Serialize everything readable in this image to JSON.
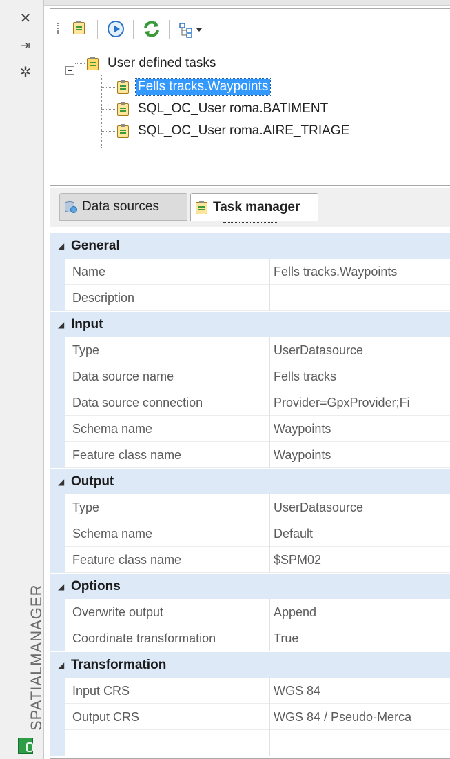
{
  "palette": {
    "title": "SPATIALMANAGER",
    "buttons": [
      {
        "icon": "close-icon",
        "glyph": "✕"
      },
      {
        "icon": "auto-hide-icon",
        "glyph": "⇥"
      },
      {
        "icon": "settings-icon",
        "glyph": "✲"
      }
    ],
    "logo_color": "#2e9e46"
  },
  "toolbar": {
    "buttons": [
      {
        "icon": "new-task-icon"
      },
      {
        "icon": "run-task-icon"
      },
      {
        "icon": "refresh-icon"
      },
      {
        "icon": "tree-view-dropdown-icon"
      }
    ]
  },
  "tree": {
    "root": {
      "label": "User defined tasks",
      "expanded": true
    },
    "items": [
      {
        "label": "Fells tracks.Waypoints",
        "selected": true
      },
      {
        "label": "SQL_OC_User roma.BATIMENT",
        "selected": false
      },
      {
        "label": "SQL_OC_User roma.AIRE_TRIAGE",
        "selected": false
      }
    ]
  },
  "tabs": [
    {
      "label": "Data sources",
      "active": false,
      "icon": "database-icon"
    },
    {
      "label": "Task manager",
      "active": true,
      "icon": "task-icon"
    }
  ],
  "grid": {
    "categories": [
      {
        "label": "General",
        "rows": [
          {
            "name": "Name",
            "value": "Fells tracks.Waypoints"
          },
          {
            "name": "Description",
            "value": ""
          }
        ]
      },
      {
        "label": "Input",
        "rows": [
          {
            "name": "Type",
            "value": "UserDatasource"
          },
          {
            "name": "Data source name",
            "value": "Fells tracks"
          },
          {
            "name": "Data source connection",
            "value": "Provider=GpxProvider;Fi"
          },
          {
            "name": "Schema name",
            "value": "Waypoints"
          },
          {
            "name": "Feature class name",
            "value": "Waypoints"
          }
        ]
      },
      {
        "label": "Output",
        "rows": [
          {
            "name": "Type",
            "value": "UserDatasource"
          },
          {
            "name": "Schema name",
            "value": "Default"
          },
          {
            "name": "Feature class name",
            "value": "$SPM02"
          }
        ]
      },
      {
        "label": "Options",
        "rows": [
          {
            "name": "Overwrite output",
            "value": "Append"
          },
          {
            "name": "Coordinate transformation",
            "value": "True"
          }
        ]
      },
      {
        "label": "Transformation",
        "rows": [
          {
            "name": "Input CRS",
            "value": "WGS 84"
          },
          {
            "name": "Output CRS",
            "value": "WGS 84 / Pseudo-Merca"
          }
        ]
      }
    ]
  },
  "colors": {
    "selection": "#3399ff",
    "category_band": "#dde9f7"
  }
}
